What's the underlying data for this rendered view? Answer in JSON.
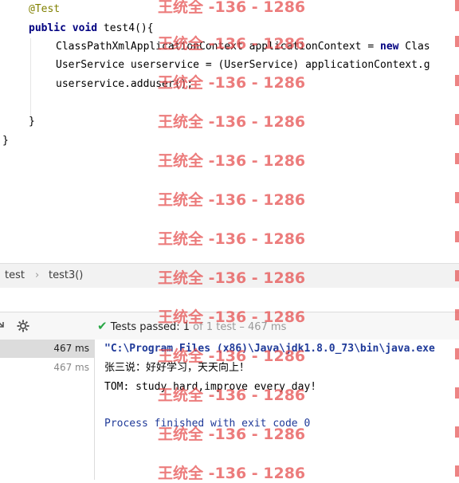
{
  "editor": {
    "annotation": "@Test",
    "kw_public": "public",
    "kw_void": "void",
    "method_sig": " test4(){",
    "line_ctx_a": "ClassPathXmlApplicationContext applicationContext = ",
    "kw_new": "new",
    "line_ctx_b": " Clas",
    "line_svc": "UserService userservice = (UserService) applicationContext.g",
    "line_call": "userservice.adduser();",
    "close_method": "}",
    "close_class": "}"
  },
  "breadcrumb": {
    "item1": "test",
    "sep": "›",
    "item2": "test3()"
  },
  "toolbar": {
    "check": "✔",
    "passed": "Tests passed: ",
    "count": "1",
    "of_total": " of 1 test",
    "duration": " – 467 ms"
  },
  "tests": {
    "row1_time": "467 ms",
    "row2_time": "467 ms"
  },
  "console": {
    "line1": "\"C:\\Program Files (x86)\\Java\\jdk1.8.0_73\\bin\\java.exe",
    "line2": "张三说：好好学习，天天向上！",
    "line3": "TOM: study hard,improve every day!",
    "line4": "Process finished with exit code 0"
  },
  "watermark": {
    "text": "王统全 -136 - 1286"
  },
  "colors": {
    "keyword": "#000080",
    "annotation": "#808000",
    "success": "#28a745",
    "process": "#1f3a99",
    "watermark": "#e65050"
  }
}
